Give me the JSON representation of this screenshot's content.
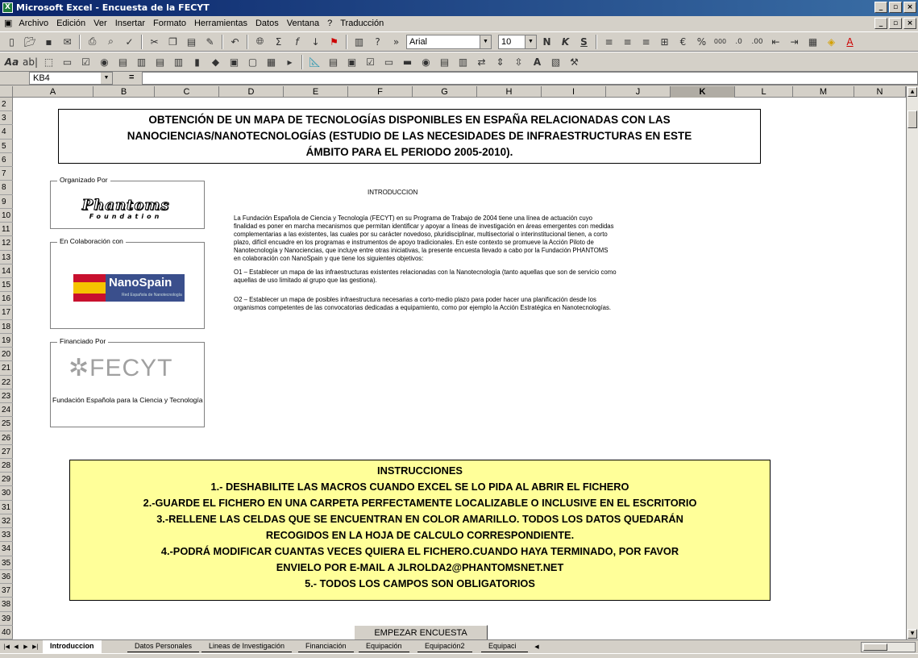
{
  "window": {
    "title": "Microsoft Excel - Encuesta de la FECYT",
    "app_icon": "excel-icon",
    "controls": [
      "minimize-icon",
      "restore-icon",
      "close-icon"
    ]
  },
  "menu": {
    "items": [
      "Archivo",
      "Edición",
      "Ver",
      "Insertar",
      "Formato",
      "Herramientas",
      "Datos",
      "Ventana",
      "?",
      "Traducción"
    ]
  },
  "toolbar": {
    "font_name": "Arial",
    "font_size": "10",
    "bold_label": "N",
    "italic_label": "K",
    "underline_label": "S",
    "percent_label": "%",
    "thousands_label": "000"
  },
  "formula_bar": {
    "name_box": "KB4",
    "equals": "=",
    "value": ""
  },
  "grid": {
    "columns": [
      "A",
      "B",
      "C",
      "D",
      "E",
      "F",
      "G",
      "H",
      "I",
      "J",
      "K",
      "L",
      "M",
      "N"
    ],
    "selected_column": "K",
    "rows": [
      "2",
      "3",
      "4",
      "5",
      "6",
      "7",
      "8",
      "9",
      "10",
      "11",
      "12",
      "13",
      "14",
      "15",
      "16",
      "17",
      "18",
      "19",
      "20",
      "21",
      "22",
      "23",
      "24",
      "25",
      "26",
      "27",
      "28",
      "29",
      "30",
      "31",
      "32",
      "33",
      "34",
      "35",
      "36",
      "37",
      "38",
      "39",
      "40"
    ]
  },
  "sheet": {
    "title_lines": [
      "OBTENCIÓN DE UN MAPA DE TECNOLOGÍAS DISPONIBLES EN ESPAÑA RELACIONADAS CON LAS",
      "NANOCIENCIAS/NANOTECNOLOGÍAS  (ESTUDIO DE LAS NECESIDADES DE INFRAESTRUCTURAS EN ESTE",
      "ÁMBITO PARA EL PERIODO 2005-2010)."
    ],
    "organized_by": {
      "label": "Organizado Por",
      "logo_text": "Phantoms",
      "logo_subtext": "Foundation"
    },
    "collaboration": {
      "label": "En Colaboración con",
      "logo_text": "NanoSpain",
      "logo_subtext": "Red Española de Nanotecnología"
    },
    "financed_by": {
      "label": "Financiado Por",
      "logo_text": "FECYT",
      "caption": "Fundación Española para la Ciencia y Tecnología"
    },
    "intro": {
      "heading": "INTRODUCCION",
      "paragraph1": "La Fundación Española de Ciencia y Tecnología (FECYT) en su Programa de Trabajo de 2004 tiene una línea de actuación cuyo finalidad es poner en marcha mecanismos que permitan identificar y apoyar a líneas de investigación en áreas emergentes con medidas complementarias a las existentes, las cuales por su carácter novedoso, pluridisciplinar, multisectorial o interinstitucional tienen, a corto plazo, difícil encuadre en los programas e instrumentos de apoyo tradicionales. En este contexto se promueve la Acción Piloto de Nanotecnología y Nanociencias, que incluye entre otras iniciativas, la presente encuesta llevado a cabo por la Fundación PHANTOMS en colaboración con NanoSpain y que tiene los siguientes objetivos:",
      "paragraph2": "O1 – Establecer un mapa de las infraestructuras existentes relacionadas con la Nanotecnología (tanto aquellas que son de servicio como aquellas de uso limitado al grupo que las gestiona).",
      "paragraph3": "O2 – Establecer un mapa de posibles infraestructura necesarias a corto-medio plazo para poder hacer una planificación desde los organismos competentes de las convocatorias dedicadas a equipamiento, como por ejemplo la Acción Estratégica en Nanotecnologías."
    },
    "instructions": {
      "heading": "INSTRUCCIONES",
      "lines": [
        "1.- DESHABILITE LAS MACROS CUANDO EXCEL SE LO PIDA AL ABRIR EL FICHERO",
        "2.-GUARDE EL FICHERO EN UNA CARPETA PERFECTAMENTE LOCALIZABLE O INCLUSIVE EN EL ESCRITORIO",
        "3.-RELLENE LAS CELDAS QUE SE ENCUENTRAN EN COLOR AMARILLO. TODOS LOS DATOS QUEDARÁN",
        "RECOGIDOS EN LA HOJA DE CALCULO CORRESPONDIENTE.",
        "4.-PODRÁ MODIFICAR CUANTAS VECES QUIERA EL FICHERO.CUANDO HAYA TERMINADO, POR FAVOR",
        "ENVIELO POR E-MAIL A JLROLDA2@PHANTOMSNET.NET",
        "5.- TODOS LOS CAMPOS SON OBLIGATORIOS"
      ],
      "background": "#ffff99"
    },
    "start_button": "EMPEZAR ENCUESTA"
  },
  "tabs": {
    "items": [
      "Introduccion",
      "Datos Personales",
      "Lineas de Investigación",
      "Financiación",
      "Equipación",
      "Equipación2",
      "Equipaci"
    ],
    "active": "Introduccion"
  },
  "colors": {
    "title_bar": "#0a246a",
    "chrome": "#d4d0c8",
    "instructions_fill": "#ffff99"
  }
}
